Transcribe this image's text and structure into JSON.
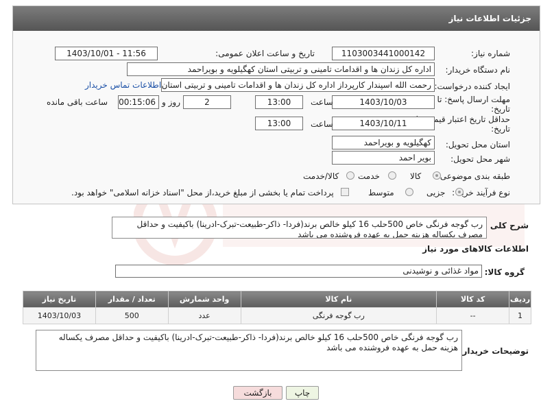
{
  "header": {
    "title": "جزئیات اطلاعات نیاز"
  },
  "fields": {
    "need_number_label": "شماره نیاز:",
    "need_number": "1103003441000142",
    "announce_label": "تاریخ و ساعت اعلان عمومی:",
    "announce_value": "1403/10/01 - 11:56",
    "buyer_org_label": "نام دستگاه خریدار:",
    "buyer_org": "اداره کل زندان ها و اقدامات تامینی و تربیتی استان کهگیلویه و بویراحمد",
    "creator_label": "ایجاد کننده درخواست:",
    "creator": "رحمت الله اسپندار کارپرداز اداره کل زندان ها و اقدامات تامینی و تربیتی استان کهگیلویه و بویراحمد",
    "buyer_contact_link": "اطلاعات تماس خریدار",
    "deadline_label_line1": "مهلت ارسال پاسخ: تا",
    "deadline_label_line2": "تاریخ:",
    "deadline_date": "1403/10/03",
    "time_label": "ساعت",
    "deadline_time": "13:00",
    "days_value": "2",
    "days_label": "روز و",
    "remaining_time": "00:15:06",
    "remaining_label": "ساعت باقی مانده",
    "validity_label_line1": "حداقل تاریخ اعتبار قیمت: تا",
    "validity_label_line2": "تاریخ:",
    "validity_date": "1403/10/11",
    "validity_time": "13:00",
    "province_label": "استان محل تحویل:",
    "province": "کهگیلویه و بویراحمد",
    "city_label": "شهر محل تحویل:",
    "city": "بویر احمد",
    "category_label": "طبقه بندی موضوعی:",
    "category_options": [
      "کالا",
      "خدمت",
      "کالا/خدمت"
    ],
    "process_label": "نوع فرآیند خرید :",
    "process_options": [
      "جزیی",
      "متوسط"
    ],
    "payment_note": "پرداخت تمام یا بخشی از مبلغ خرید،از محل \"اسناد خزانه اسلامی\" خواهد بود."
  },
  "summary": {
    "label": "شرح کلی نیاز:",
    "text": "رب گوجه فرنگی خاص 500حلب 16 کیلو خالص برند(فردا- ذاکر-طبیعت-تبرک-ادرینا) باکیفیت و حداقل مصرف یکساله هزینه حمل به عهده فروشنده می باشد"
  },
  "goods_section": {
    "title": "اطلاعات کالاهای مورد نیاز",
    "group_label": "گروه کالا:",
    "group_value": "مواد غذائی و نوشیدنی"
  },
  "table": {
    "headers": [
      "ردیف",
      "کد کالا",
      "نام کالا",
      "واحد شمارش",
      "تعداد / مقدار",
      "تاریخ نیاز"
    ],
    "rows": [
      [
        "1",
        "--",
        "رب گوجه فرنگی",
        "عدد",
        "500",
        "1403/10/03"
      ]
    ]
  },
  "buyer_notes": {
    "label": "توضیحات خریدار:",
    "text": "رب گوجه فرنگی خاص 500حلب 16 کیلو خالص برند(فردا- ذاکر-طبیعت-تبرک-ادرینا) باکیفیت و حداقل مصرف یکساله هزینه حمل به عهده فروشنده می باشد"
  },
  "buttons": {
    "print": "چاپ",
    "back": "بازگشت"
  },
  "colors": {
    "header": "#5c5c5c",
    "link": "#1a4fa6",
    "back_button": "#f6dcdc",
    "print_button": "#eef5e3"
  }
}
